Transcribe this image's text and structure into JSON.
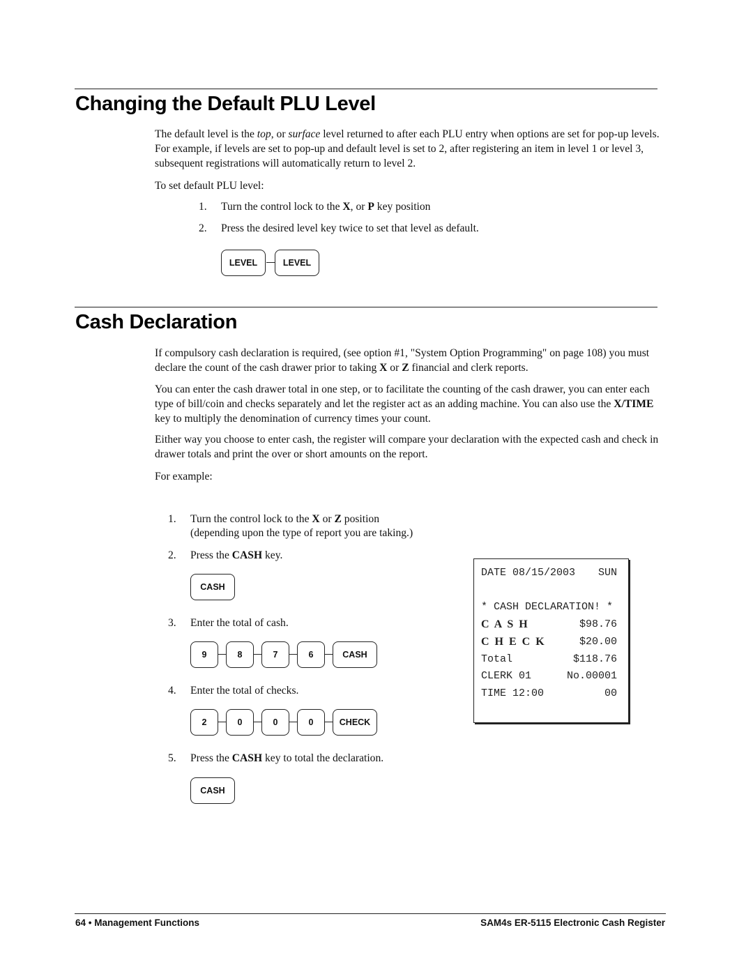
{
  "section1": {
    "title": "Changing the Default PLU Level",
    "paragraph": {
      "pre": "The default level is the ",
      "em1": "top",
      "mid": ", or ",
      "em2": "surface",
      "post": " level returned to after each PLU entry when options are set for pop-up levels.  For example, if levels are set to pop-up and default level is set to 2, after registering an item in level 1 or level 3, subsequent registrations will automatically return to level 2."
    },
    "intro": "To set default PLU level:",
    "steps": [
      {
        "num": "1.",
        "pre": "Turn the control lock to the ",
        "b1": "X",
        "mid": ", or ",
        "b2": "P",
        "post": " key position"
      },
      {
        "num": "2.",
        "text": "Press the desired level key twice to set that level as default."
      }
    ],
    "keys": [
      "LEVEL",
      "LEVEL"
    ]
  },
  "section2": {
    "title": "Cash Declaration",
    "p1": {
      "pre": "If compulsory cash declaration is required, (see option #1, \"System Option Programming\" on page 108) you must declare the count of the cash drawer prior to taking ",
      "b1": "X",
      "mid": " or ",
      "b2": "Z",
      "post": " financial and clerk reports."
    },
    "p2": {
      "pre": "You can enter the cash drawer total in one step, or to facilitate the counting of the cash drawer, you can enter each type of bill/coin and checks separately and let the register act as an adding machine. You can also use the ",
      "b1": "X/TIME",
      "post": " key to multiply the denomination of currency times your count."
    },
    "p3": "Either way you choose to enter cash, the register will compare your declaration with the expected cash and check in drawer totals and print the over or short amounts on the report.",
    "p4": "For example:",
    "steps": [
      {
        "num": "1.",
        "pre": "Turn the control lock to the ",
        "b1": "X",
        "mid": " or ",
        "b2": "Z",
        "post": " position",
        "line2": "(depending upon the type of report you are taking.)"
      },
      {
        "num": "2.",
        "pre": "Press the ",
        "b1": "CASH",
        "post": " key.",
        "keys": [
          "CASH"
        ]
      },
      {
        "num": "3.",
        "text": "Enter the total of cash.",
        "keys": [
          "9",
          "8",
          "7",
          "6",
          "CASH"
        ]
      },
      {
        "num": "4.",
        "text": "Enter the total of checks.",
        "keys": [
          "2",
          "0",
          "0",
          "0",
          "CHECK"
        ]
      },
      {
        "num": "5.",
        "pre": "Press the ",
        "b1": "CASH",
        "post": " key to total the declaration.",
        "keys": [
          "CASH"
        ]
      }
    ],
    "receipt": {
      "date_label": "DATE 08/15/2003",
      "day": "SUN",
      "heading": "* CASH DECLARATION! *",
      "rows": [
        {
          "label": "C A S H",
          "value": "$98.76",
          "bold": true
        },
        {
          "label": "C H E C K",
          "value": "$20.00",
          "bold": true
        },
        {
          "label": "Total",
          "value": "$118.76"
        },
        {
          "label": "CLERK 01",
          "value": "No.00001"
        },
        {
          "label": "TIME 12:00",
          "value": "00"
        }
      ]
    }
  },
  "footer": {
    "left": "64 • Management Functions",
    "right": "SAM4s ER-5115 Electronic Cash Register"
  }
}
